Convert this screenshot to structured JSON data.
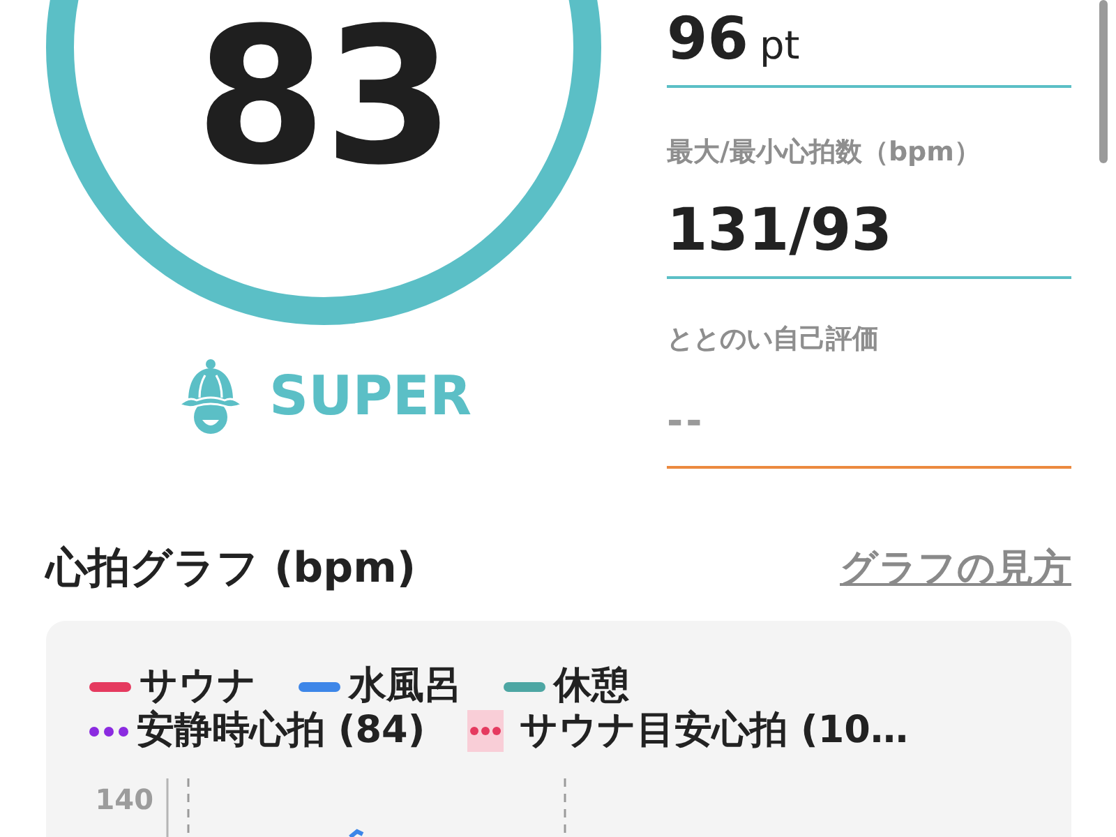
{
  "score": {
    "value": "83",
    "rank": "SUPER"
  },
  "stats": [
    {
      "kind": "number",
      "value": "96",
      "unit": "pt",
      "color": "#5bbfc6"
    },
    {
      "kind": "number",
      "label": "最大/最小心拍数（bpm）",
      "value": "131/93",
      "color": "#5bbfc6"
    },
    {
      "kind": "placeholder",
      "label": "ととのい自己評価",
      "value": "--",
      "color": "#ec8a3f"
    }
  ],
  "heart_rate_graph": {
    "title": "心拍グラフ (bpm)",
    "help_link": "グラフの見方",
    "legend": [
      {
        "kind": "line",
        "label": "サウナ",
        "color": "#e53a5f"
      },
      {
        "kind": "line",
        "label": "水風呂",
        "color": "#3d86e8"
      },
      {
        "kind": "line",
        "label": "休憩",
        "color": "#4da6a3"
      },
      {
        "kind": "dots",
        "label": "安静時心拍 (84)",
        "color": "#8b2be0"
      },
      {
        "kind": "dots-boxed",
        "label": "サウナ目安心拍 (10…",
        "color": "#e53a5f"
      }
    ],
    "y_axis_labels": [
      "140"
    ]
  }
}
